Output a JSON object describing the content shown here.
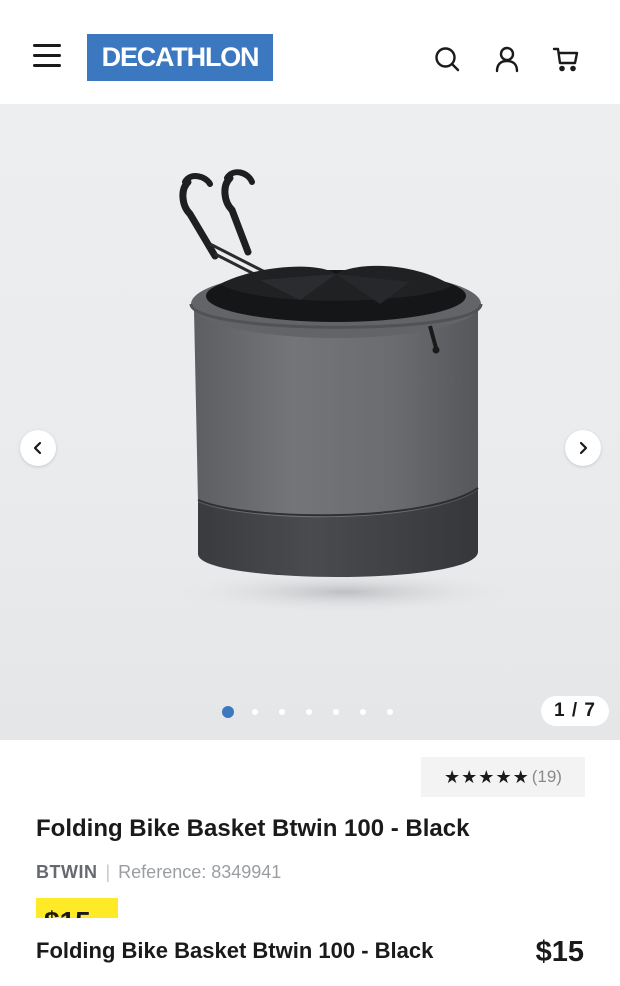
{
  "header": {
    "logo_text": "DECATHLON",
    "logo_color": "#3c78c0",
    "icons": [
      "menu-icon",
      "search-icon",
      "account-icon",
      "cart-icon"
    ]
  },
  "gallery": {
    "counter": "1 / 7",
    "current_index": 1,
    "total_images": 7,
    "image_subject": "bike-basket"
  },
  "product": {
    "rating_stars": "★★★★★",
    "rating_count": "(19)",
    "rating_value": 4.5,
    "title": "Folding Bike Basket Btwin 100 - Black",
    "brand": "BTWIN",
    "separator": "|",
    "reference": "Reference: 8349941",
    "price": "$15",
    "price_tag_color": "#ffea28"
  },
  "sticky_bar": {
    "title": "Folding Bike Basket Btwin 100 - Black",
    "price": "$15"
  }
}
